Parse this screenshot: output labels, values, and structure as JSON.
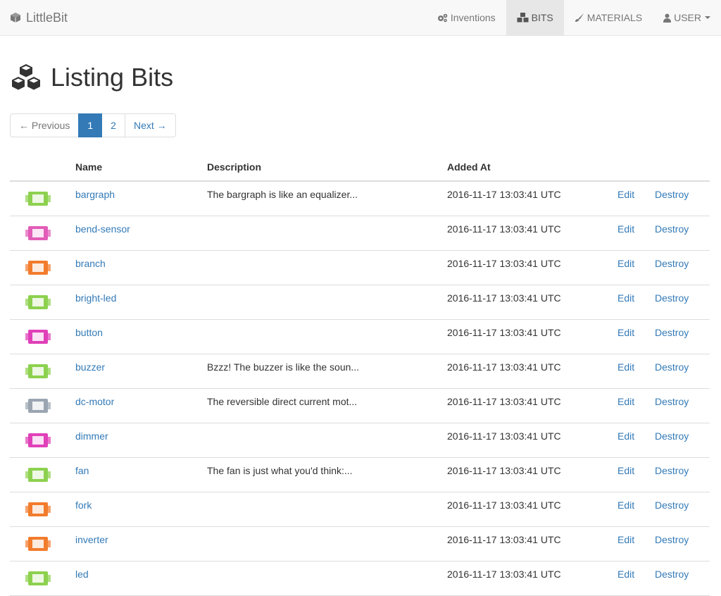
{
  "brand": {
    "label": "LittleBit",
    "icon": "cube-icon"
  },
  "nav": [
    {
      "name": "inventions",
      "label": "Inventions",
      "icon": "cogs-icon",
      "active": false
    },
    {
      "name": "bits",
      "label": "BITS",
      "icon": "cubes-icon",
      "active": true
    },
    {
      "name": "materials",
      "label": "MATERIALS",
      "icon": "brush-icon",
      "active": false
    },
    {
      "name": "user",
      "label": "USER",
      "icon": "user-icon",
      "active": false,
      "dropdown": true
    }
  ],
  "page": {
    "title": "Listing Bits",
    "icon": "cubes-icon"
  },
  "pager": {
    "previous": "← Previous",
    "pages": [
      "1",
      "2"
    ],
    "current": "1",
    "next": "Next →"
  },
  "table": {
    "headers": {
      "image": "",
      "name": "Name",
      "description": "Description",
      "added_at": "Added At"
    },
    "edit_label": "Edit",
    "destroy_label": "Destroy",
    "rows": [
      {
        "name": "bargraph",
        "description": "The bargraph is like an equalizer...",
        "added_at": "2016-11-17 13:03:41 UTC",
        "color": "#8dd14f"
      },
      {
        "name": "bend-sensor",
        "description": "",
        "added_at": "2016-11-17 13:03:41 UTC",
        "color": "#e25db8"
      },
      {
        "name": "branch",
        "description": "",
        "added_at": "2016-11-17 13:03:41 UTC",
        "color": "#f27c2d"
      },
      {
        "name": "bright-led",
        "description": "",
        "added_at": "2016-11-17 13:03:41 UTC",
        "color": "#8dd14f"
      },
      {
        "name": "button",
        "description": "",
        "added_at": "2016-11-17 13:03:41 UTC",
        "color": "#e040b8"
      },
      {
        "name": "buzzer",
        "description": "Bzzz! The buzzer is like the soun...",
        "added_at": "2016-11-17 13:03:41 UTC",
        "color": "#8dd14f"
      },
      {
        "name": "dc-motor",
        "description": "The reversible direct current mot...",
        "added_at": "2016-11-17 13:03:41 UTC",
        "color": "#9aa5b1"
      },
      {
        "name": "dimmer",
        "description": "",
        "added_at": "2016-11-17 13:03:41 UTC",
        "color": "#e040b8"
      },
      {
        "name": "fan",
        "description": "The fan is just what you'd think:...",
        "added_at": "2016-11-17 13:03:41 UTC",
        "color": "#8dd14f"
      },
      {
        "name": "fork",
        "description": "",
        "added_at": "2016-11-17 13:03:41 UTC",
        "color": "#f27c2d"
      },
      {
        "name": "inverter",
        "description": "",
        "added_at": "2016-11-17 13:03:41 UTC",
        "color": "#f27c2d"
      },
      {
        "name": "led",
        "description": "",
        "added_at": "2016-11-17 13:03:41 UTC",
        "color": "#8dd14f"
      }
    ]
  }
}
